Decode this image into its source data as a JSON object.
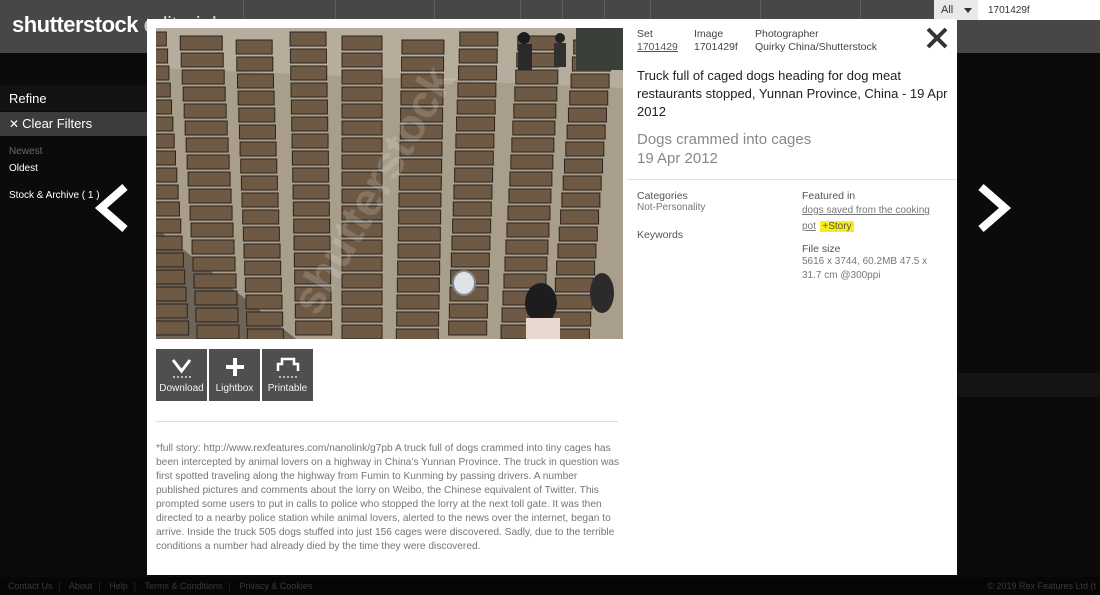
{
  "header": {
    "logo_primary": "shutterstock",
    "logo_secondary": "editorial",
    "search": {
      "scope": "All",
      "value": "1701429f"
    }
  },
  "sidebar": {
    "refine": "Refine",
    "clear_filters": "Clear Filters",
    "sort_newest": "Newest",
    "sort_oldest": "Oldest",
    "facet": "Stock & Archive ( 1 )"
  },
  "footer": {
    "links": [
      "Contact Us",
      "About",
      "Help",
      "Terms & Conditions",
      "Privacy & Cookies"
    ],
    "copyright": "© 2019 Rex Features Ltd (t"
  },
  "modal": {
    "meta": {
      "set_label": "Set",
      "set_value": "1701429",
      "image_label": "Image",
      "image_value": "1701429f",
      "photographer_label": "Photographer",
      "photographer_value": "Quirky China/Shutterstock"
    },
    "headline": "Truck full of caged dogs heading for dog meat restaurants stopped, Yunnan Province, China - 19 Apr 2012",
    "subtitle": "Dogs crammed into cages",
    "date": "19 Apr 2012",
    "categories_label": "Categories",
    "categories_value": "Not-Personality",
    "keywords_label": "Keywords",
    "featured_label": "Featured in",
    "featured_link": "dogs saved from the cooking pot",
    "story_tag": "+Story",
    "filesize_label": "File size",
    "filesize_value": "5616 x 3744, 60.2MB 47.5 x 31.7 cm @300ppi",
    "tools": {
      "download": "Download",
      "lightbox": "Lightbox",
      "printable": "Printable"
    },
    "description": "*full story: http://www.rexfeatures.com/nanolink/g7pb A truck full of dogs crammed into tiny cages has been intercepted by animal lovers on a highway in China's Yunnan Province. The truck in question was first spotted traveling along the highway from Fumin to Kunming by passing drivers. A number published pictures and comments about the lorry on Weibo, the Chinese equivalent of Twitter. This prompted some users to put in calls to police who stopped the lorry at the next toll gate. It was then directed to a nearby police station while animal lovers, alerted to the news over the internet, began to arrive. Inside the truck 505 dogs stuffed into just 156 cages were discovered. Sadly, due to the terrible conditions a number had already died by the time they were discovered.",
    "watermark": "shutterstock"
  },
  "icons": {
    "close": "close-icon",
    "prev": "chevron-left-icon",
    "next": "chevron-right-icon",
    "download": "download-icon",
    "lightbox": "plus-icon",
    "printable": "print-icon"
  }
}
